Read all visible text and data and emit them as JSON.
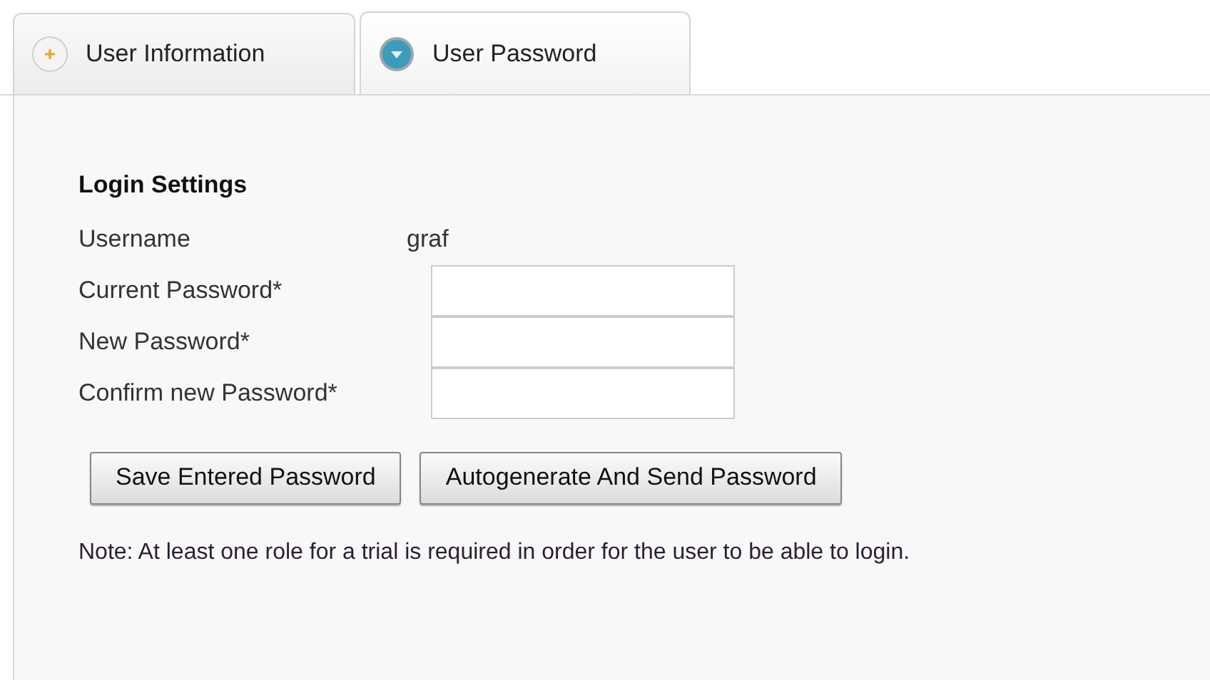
{
  "tabs": [
    {
      "label": "User Information",
      "selected": false
    },
    {
      "label": "User Password",
      "selected": true
    }
  ],
  "section": {
    "title": "Login Settings"
  },
  "rows": [
    {
      "kind": "text",
      "label": "Username",
      "value": "graf"
    },
    {
      "kind": "input",
      "label": "Current Password*"
    },
    {
      "kind": "input",
      "label": "New Password*"
    },
    {
      "kind": "input",
      "label": "Confirm new Password*"
    }
  ],
  "buttons": [
    "Save Entered Password",
    "Autogenerate And Send Password"
  ],
  "note": "Note: At least one role for a trial is required in order for the user to be able to login."
}
